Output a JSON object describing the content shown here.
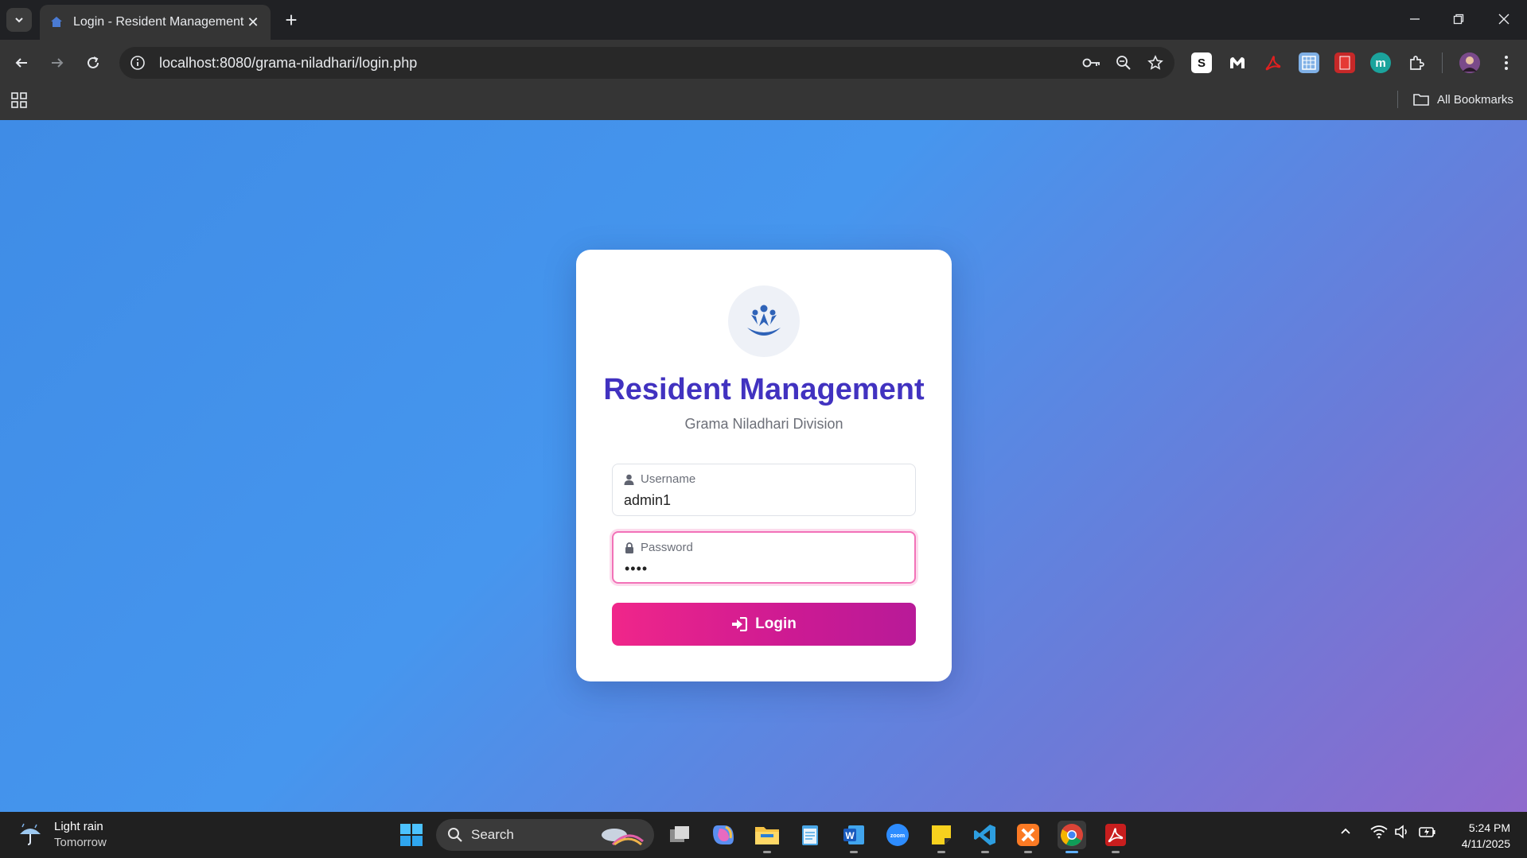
{
  "browser": {
    "tab": {
      "title": "Login - Resident Management"
    },
    "url": "localhost:8080/grama-niladhari/login.php",
    "bookmarks_label": "All Bookmarks"
  },
  "login_card": {
    "title": "Resident Management",
    "subtitle": "Grama Niladhari Division",
    "username": {
      "label": "Username",
      "value": "admin1"
    },
    "password": {
      "label": "Password",
      "value": "••••"
    },
    "submit_label": "Login"
  },
  "taskbar": {
    "weather": {
      "condition": "Light rain",
      "when": "Tomorrow"
    },
    "search_placeholder": "Search",
    "time": "5:24 PM",
    "date": "4/11/2025"
  },
  "colors": {
    "title": "#4132c0",
    "button_start": "#f0268a",
    "button_end": "#b81a98",
    "focus_ring": "#f272b8"
  }
}
